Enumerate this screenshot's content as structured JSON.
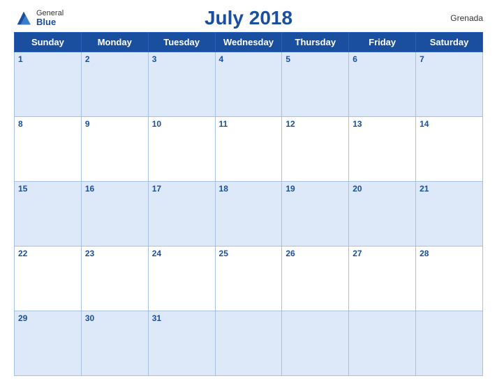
{
  "header": {
    "title": "July 2018",
    "country": "Grenada",
    "logo": {
      "general": "General",
      "blue": "Blue"
    }
  },
  "days_of_week": [
    "Sunday",
    "Monday",
    "Tuesday",
    "Wednesday",
    "Thursday",
    "Friday",
    "Saturday"
  ],
  "weeks": [
    [
      1,
      2,
      3,
      4,
      5,
      6,
      7
    ],
    [
      8,
      9,
      10,
      11,
      12,
      13,
      14
    ],
    [
      15,
      16,
      17,
      18,
      19,
      20,
      21
    ],
    [
      22,
      23,
      24,
      25,
      26,
      27,
      28
    ],
    [
      29,
      30,
      31,
      null,
      null,
      null,
      null
    ]
  ]
}
